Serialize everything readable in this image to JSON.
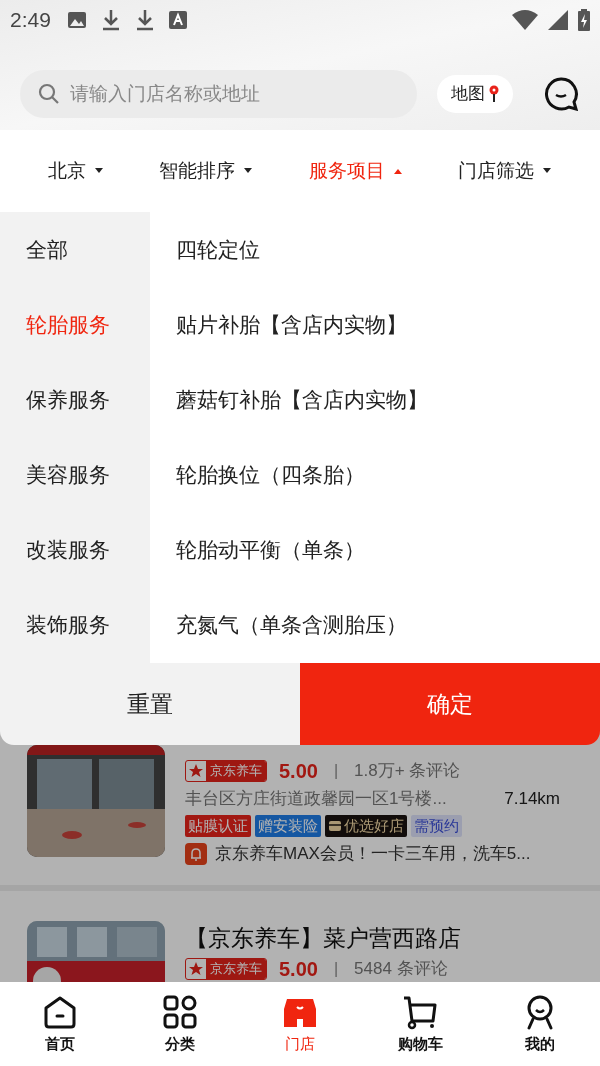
{
  "status_bar": {
    "time": "2:49"
  },
  "search": {
    "placeholder": "请输入门店名称或地址"
  },
  "map_button": {
    "label": "地图"
  },
  "filters": [
    {
      "label": "北京",
      "selected": false
    },
    {
      "label": "智能排序",
      "selected": false
    },
    {
      "label": "服务项目",
      "selected": true
    },
    {
      "label": "门店筛选",
      "selected": false
    }
  ],
  "categories": [
    {
      "label": "全部",
      "selected": false
    },
    {
      "label": "轮胎服务",
      "selected": true
    },
    {
      "label": "保养服务",
      "selected": false
    },
    {
      "label": "美容服务",
      "selected": false
    },
    {
      "label": "改装服务",
      "selected": false
    },
    {
      "label": "装饰服务",
      "selected": false
    }
  ],
  "services": [
    "四轮定位",
    "贴片补胎【含店内实物】",
    "蘑菇钉补胎【含店内实物】",
    "轮胎换位（四条胎）",
    "轮胎动平衡（单条）",
    "充氮气（单条含测胎压）"
  ],
  "actions": {
    "reset": "重置",
    "confirm": "确定"
  },
  "stores": [
    {
      "badge": "京东养车",
      "rating": "5.00",
      "separator": "|",
      "reviews": "1.8万+ 条评论",
      "address": "丰台区方庄街道政馨园一区1号楼...",
      "distance": "7.14km",
      "tags": [
        {
          "label": "贴膜认证",
          "kind": "red"
        },
        {
          "label": "赠安装险",
          "kind": "blue"
        },
        {
          "label": "优选好店",
          "kind": "dark"
        },
        {
          "label": "需预约",
          "kind": "light"
        }
      ],
      "promo": "京东养车MAX会员！一卡三车用，洗车5..."
    },
    {
      "title": "【京东养车】菜户营西路店",
      "badge": "京东养车",
      "rating": "5.00",
      "separator": "|",
      "reviews": "5484 条评论"
    }
  ],
  "nav": [
    {
      "label": "首页",
      "kind": "home",
      "selected": false
    },
    {
      "label": "分类",
      "kind": "grid",
      "selected": false
    },
    {
      "label": "门店",
      "kind": "store",
      "selected": true
    },
    {
      "label": "购物车",
      "kind": "cart",
      "selected": false
    },
    {
      "label": "我的",
      "kind": "user",
      "selected": false
    }
  ]
}
